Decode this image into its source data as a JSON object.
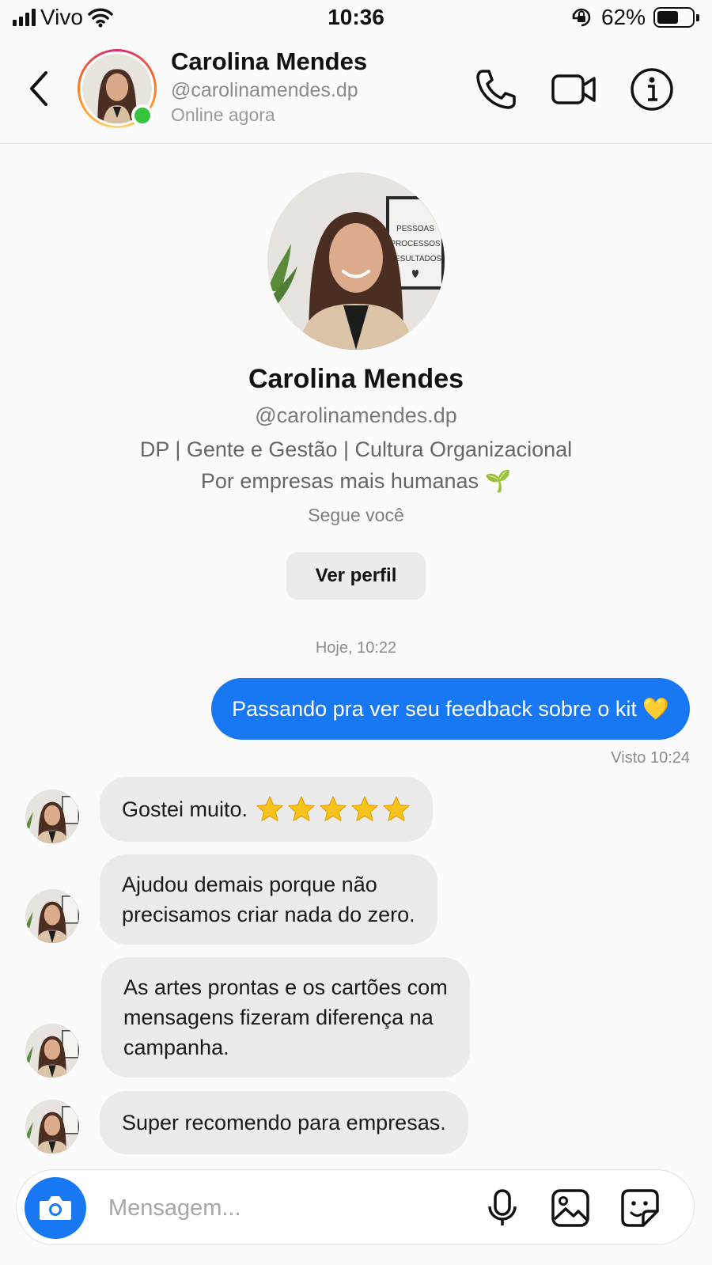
{
  "status_bar": {
    "carrier": "Vivo",
    "time": "10:36",
    "battery_percent": "62%",
    "battery_level": 0.62,
    "icons": [
      "signal-icon",
      "wifi-icon",
      "rotation-lock-icon",
      "battery-icon"
    ]
  },
  "header": {
    "name": "Carolina Mendes",
    "handle": "@carolinamendes.dp",
    "status": "Online agora",
    "icons": [
      "back-icon",
      "phone-icon",
      "video-icon",
      "info-icon"
    ]
  },
  "profile": {
    "name": "Carolina Mendes",
    "handle": "@carolinamendes.dp",
    "bio_line1": "DP | Gente e Gestão | Cultura Organizacional",
    "bio_line2": "Por empresas mais humanas 🌱",
    "follows": "Segue você",
    "view_profile_label": "Ver perfil",
    "frame_text": [
      "PESSOAS",
      "PROCESSOS",
      "RESULTADOS"
    ]
  },
  "conversation": {
    "timestamp": "Hoje, 10:22",
    "outgoing": {
      "text": "Passando pra ver seu feedback sobre o kit 💛",
      "seen": "Visto 10:24"
    },
    "incoming": [
      {
        "line1": "Gostei muito.",
        "rating": 5
      },
      {
        "line1": "Ajudou demais porque não",
        "line2": "precisamos criar nada do zero."
      },
      {
        "line1": "As artes prontas e os cartões com",
        "line2": "mensagens fizeram diferença na",
        "line3": "campanha."
      },
      {
        "line1": "Super recomendo para empresas."
      }
    ]
  },
  "composer": {
    "placeholder": "Mensagem...",
    "icons": [
      "camera-icon",
      "microphone-icon",
      "gallery-icon",
      "sticker-icon"
    ]
  },
  "colors": {
    "accent": "#1877f2",
    "online": "#35c43b",
    "incoming_bubble": "#ebebeb"
  }
}
